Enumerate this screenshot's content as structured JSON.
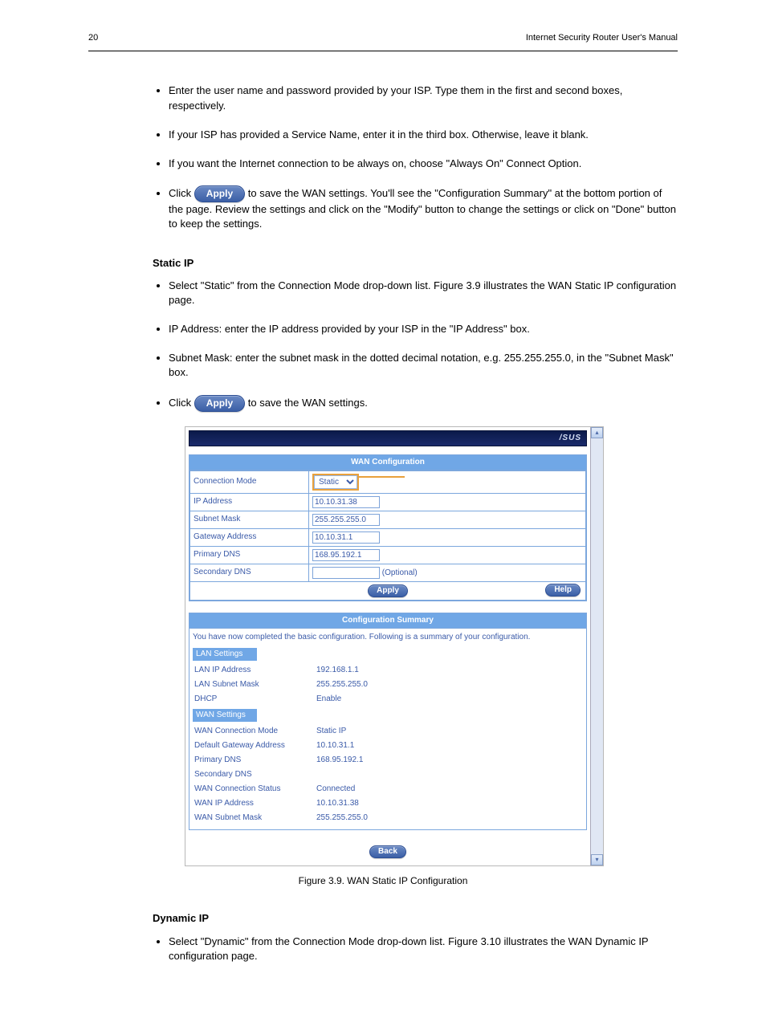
{
  "header": {
    "page_number": "20",
    "doc_title": "Internet Security Router User's Manual"
  },
  "bullets": [
    "Enter the user name and password provided by your ISP. Type them in the first and second boxes, respectively.",
    "If your ISP has provided a Service Name, enter it in the third box. Otherwise, leave it blank.",
    "If you want the Internet connection to be always on, choose \"Always On\" Connect Option.",
    {
      "prefix": "Click ",
      "pill": "Apply",
      "suffix": " to save the WAN settings. You'll see the \"Configuration Summary\" at the bottom portion of the page. Review the settings and click on the \"Modify\" button to change the settings or click on \"Done\" button to keep the settings."
    }
  ],
  "static_section": {
    "bullets": [
      "Select \"Static\" from the Connection Mode drop-down list. Figure 3.9 illustrates the WAN Static IP configuration page.",
      "IP Address: enter the IP address provided by your ISP in the \"IP Address\" box.",
      "Subnet Mask: enter the subnet mask in the dotted decimal notation, e.g. 255.255.255.0, in the \"Subnet Mask\" box.",
      {
        "prefix": "Click ",
        "pill": "Apply",
        "suffix": " to save the WAN settings."
      }
    ],
    "figure_caption": "Figure 3.9. WAN Static IP Configuration"
  },
  "dynamic_section": {
    "title": "Dynamic IP",
    "bullet": "Select \"Dynamic\" from the Connection Mode drop-down list. Figure 3.10 illustrates the WAN Dynamic IP configuration page."
  },
  "shot": {
    "brand": "/SUS",
    "wan_title": "WAN Configuration",
    "rows": {
      "connection_mode": {
        "label": "Connection Mode",
        "value": "Static"
      },
      "ip_address": {
        "label": "IP Address",
        "value": "10.10.31.38"
      },
      "subnet_mask": {
        "label": "Subnet Mask",
        "value": "255.255.255.0"
      },
      "gateway": {
        "label": "Gateway Address",
        "value": "10.10.31.1"
      },
      "primary_dns": {
        "label": "Primary DNS",
        "value": "168.95.192.1"
      },
      "secondary_dns": {
        "label": "Secondary DNS",
        "value": "",
        "note": "(Optional)"
      }
    },
    "buttons": {
      "apply": "Apply",
      "help": "Help",
      "back": "Back"
    },
    "summary": {
      "title": "Configuration Summary",
      "intro": "You have now completed the basic configuration. Following is a summary of your configuration.",
      "lan_head": "LAN Settings",
      "lan": {
        "ip": {
          "k": "LAN IP Address",
          "v": "192.168.1.1"
        },
        "mask": {
          "k": "LAN Subnet Mask",
          "v": "255.255.255.0"
        },
        "dhcp": {
          "k": "DHCP",
          "v": "Enable"
        }
      },
      "wan_head": "WAN Settings",
      "wan": {
        "mode": {
          "k": "WAN Connection Mode",
          "v": "Static IP"
        },
        "gw": {
          "k": "Default Gateway Address",
          "v": "10.10.31.1"
        },
        "pdns": {
          "k": "Primary DNS",
          "v": "168.95.192.1"
        },
        "sdns": {
          "k": "Secondary DNS",
          "v": ""
        },
        "status": {
          "k": "WAN Connection Status",
          "v": "Connected"
        },
        "wip": {
          "k": "WAN IP Address",
          "v": "10.10.31.38"
        },
        "wmask": {
          "k": "WAN Subnet Mask",
          "v": "255.255.255.0"
        }
      }
    }
  }
}
